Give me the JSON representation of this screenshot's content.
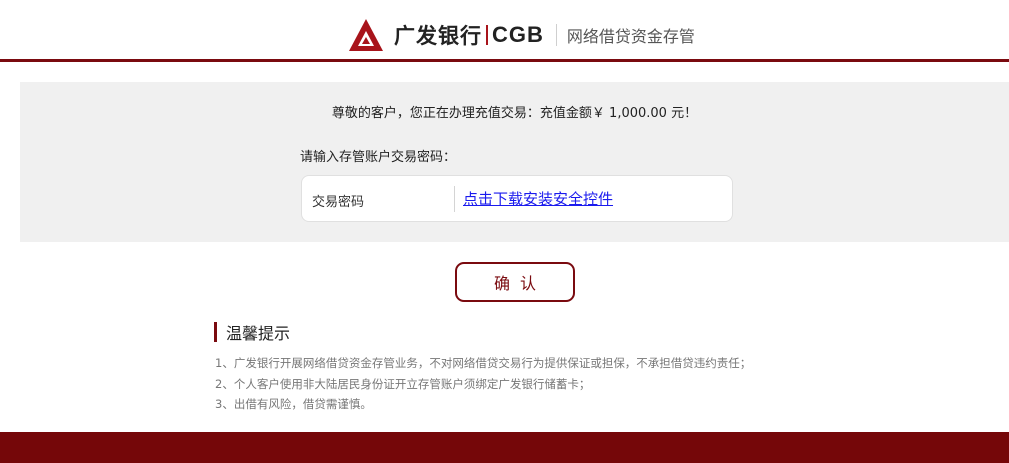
{
  "header": {
    "bank_name_cn": "广发银行",
    "bank_name_en": "CGB",
    "subtitle": "网络借贷资金存管",
    "brand_color": "#a8141b",
    "theme_color": "#7a0a0f"
  },
  "panel": {
    "notice": "尊敬的客户，您正在办理充值交易：充值金额￥ 1,000.00 元！",
    "prompt": "请输入存管账户交易密码：",
    "password_label": "交易密码",
    "download_link": "点击下载安装安全控件"
  },
  "confirm_label": "确认",
  "tips": {
    "title": "温馨提示",
    "items": [
      "1、广发银行开展网络借贷资金存管业务，不对网络借贷交易行为提供保证或担保，不承担借贷违约责任；",
      "2、个人客户使用非大陆居民身份证开立存管账户须绑定广发银行储蓄卡；",
      "3、出借有风险，借贷需谨慎。"
    ]
  }
}
